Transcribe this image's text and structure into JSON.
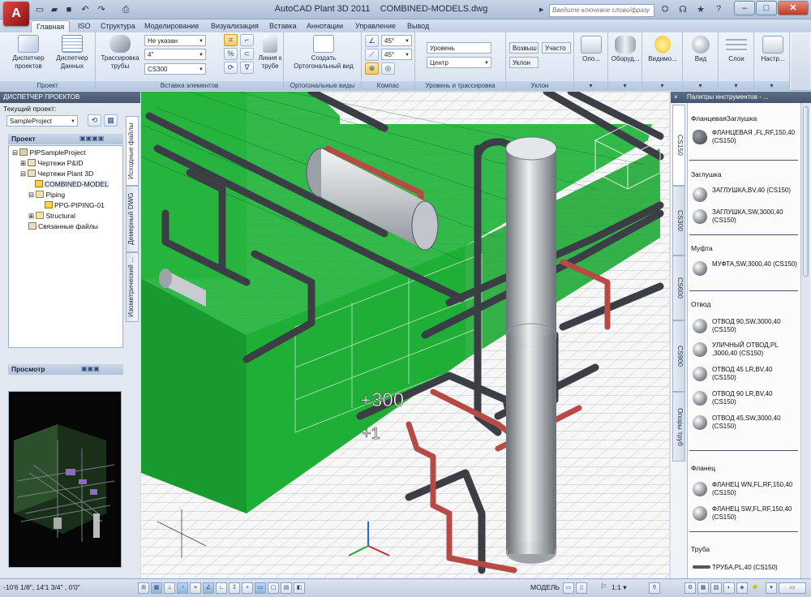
{
  "title_bar": {
    "app_title": "AutoCAD Plant 3D 2011",
    "document": "COMBINED-MODELS.dwg",
    "search_placeholder": "Введите ключевое слово/фразу",
    "logo_letter": "A"
  },
  "menu_tabs": [
    "Главная",
    "ISO",
    "Структура",
    "Моделирование",
    "Визуализация",
    "Вставка",
    "Аннотации",
    "Управление",
    "Вывод"
  ],
  "ribbon": {
    "project_panel": {
      "title": "Проект",
      "btn1": "Диспетчер проектов",
      "btn2": "Диспетчер Данных"
    },
    "insert_panel": {
      "title": "Вставка элементов",
      "route_btn": "Трассировка трубы",
      "combo_spec": "Не указан",
      "combo_size": "4\"",
      "combo_class": "CS300",
      "line_btn": "Линия к трубе"
    },
    "ortho_panel": {
      "title": "Ортогональные виды",
      "btn": "Создать Ортогональный вид"
    },
    "compass_panel": {
      "title": "Компас",
      "angle1": "45°",
      "angle2": "45°"
    },
    "level_panel": {
      "title": "Уровень и трассировка",
      "combo_level": "Уровень",
      "combo_center": "Центр"
    },
    "slope_panel": {
      "title": "Уклон",
      "btn_rise": "Возвыш",
      "btn_section": "Участо",
      "btn_slope": "Уклон"
    },
    "right_buttons": [
      "Опо...",
      "Оборуд...",
      "Видимо...",
      "Вид",
      "Слои",
      "Настр..."
    ]
  },
  "project_manager": {
    "header": "ДИСПЕТЧЕР ПРОЕКТОВ",
    "current_label": "Текущий проект:",
    "current_value": "SampleProject",
    "section_project": "Проект",
    "tree": [
      "PIPSampleProject",
      "Чертежи P&ID",
      "Чертежи Plant 3D",
      "COMBINED-MODEL",
      "Piping",
      "PPG-PIPING-01",
      "Structural",
      "Связанные файлы"
    ],
    "side_tabs": [
      "Исходные файлы",
      "Демерный DWG",
      "Изометрический ..."
    ],
    "section_preview": "Просмотр"
  },
  "tool_palettes": {
    "header": "Палитры инструментов - ...",
    "tabs": [
      "CS150",
      "CS300",
      "CS600",
      "CS900",
      "Опоры труб"
    ],
    "categories": [
      {
        "title": "ФланцеваяЗаглушка",
        "items": [
          "ФЛАНЦЕВАЯ ,FL,RF,150,40 (CS150)"
        ]
      },
      {
        "title": "Заглушка",
        "items": [
          "ЗАГЛУШКА,BV,40 (CS150)",
          "ЗАГЛУШКА,SW,3000,40 (CS150)"
        ]
      },
      {
        "title": "Муфта",
        "items": [
          "МУФТА,SW,3000,40 (CS150)"
        ]
      },
      {
        "title": "Отвод",
        "items": [
          "ОТВОД 90,SW,3000,40 (CS150)",
          "УЛИЧНЫЙ ОТВОД,PL ,3000,40 (CS150)",
          "ОТВОД 45 LR,BV,40 (CS150)",
          "ОТВОД 90 LR,BV,40 (CS150)",
          "ОТВОД 45,SW,3000,40 (CS150)"
        ]
      },
      {
        "title": "Фланец",
        "items": [
          "ФЛАНЕЦ WN,FL,RF,150,40 (CS150)",
          "ФЛАНЕЦ SW,FL,RF,150,40 (CS150)"
        ]
      },
      {
        "title": "Труба",
        "items": [
          "ТРУБА,PL,40 (CS150)"
        ]
      }
    ]
  },
  "viewport": {
    "dim_text1": "+300",
    "dim_text2": "+1"
  },
  "status_bar": {
    "coords": "-10'6 1/8\", 14'1 3/4\" , 0'0\"",
    "model_label": "МОДЕЛЬ",
    "scale": "1:1"
  },
  "colors": {
    "steel": "#22c55e",
    "pipe_dark": "#3d4046",
    "pipe_red": "#c0504d",
    "vessel": "#b8bcc2"
  }
}
